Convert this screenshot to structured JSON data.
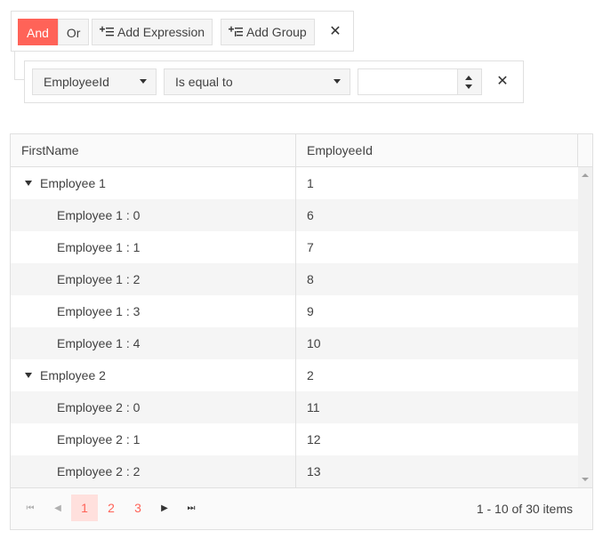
{
  "filter": {
    "logic_and": "And",
    "logic_or": "Or",
    "add_expression": "Add Expression",
    "add_group": "Add Group",
    "remove_group_icon": "close-icon",
    "expression": {
      "field": "EmployeeId",
      "operator": "Is equal to",
      "value": "",
      "remove_icon": "close-icon"
    }
  },
  "grid": {
    "columns": [
      "FirstName",
      "EmployeeId"
    ],
    "rows": [
      {
        "name": "Employee 1",
        "id": "1",
        "parent": true
      },
      {
        "name": "Employee 1 : 0",
        "id": "6",
        "parent": false
      },
      {
        "name": "Employee 1 : 1",
        "id": "7",
        "parent": false
      },
      {
        "name": "Employee 1 : 2",
        "id": "8",
        "parent": false
      },
      {
        "name": "Employee 1 : 3",
        "id": "9",
        "parent": false
      },
      {
        "name": "Employee 1 : 4",
        "id": "10",
        "parent": false
      },
      {
        "name": "Employee 2",
        "id": "2",
        "parent": true
      },
      {
        "name": "Employee 2 : 0",
        "id": "11",
        "parent": false
      },
      {
        "name": "Employee 2 : 1",
        "id": "12",
        "parent": false
      },
      {
        "name": "Employee 2 : 2",
        "id": "13",
        "parent": false
      }
    ]
  },
  "pager": {
    "pages": [
      "1",
      "2",
      "3"
    ],
    "current_page": "1",
    "info": "1 - 10 of 30 items"
  },
  "colors": {
    "accent": "#ff6358",
    "accent_light": "#ffe0dd",
    "border": "#e0e0e0",
    "alt_row": "#f5f5f5"
  }
}
